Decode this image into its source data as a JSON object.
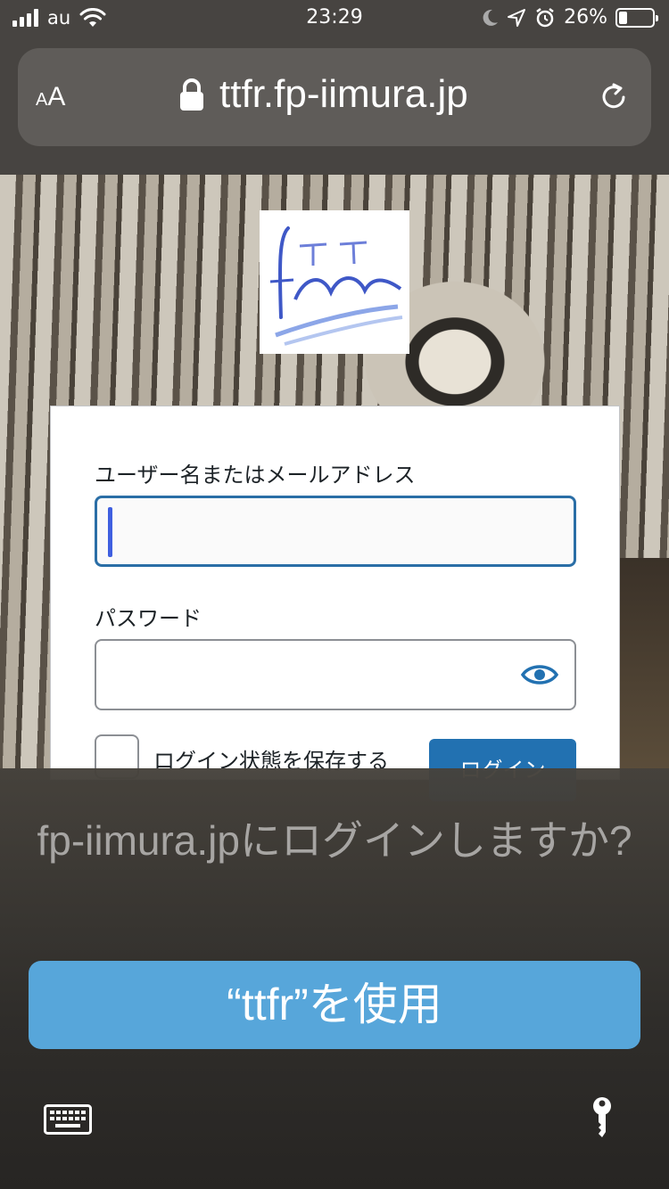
{
  "status_bar": {
    "carrier": "au",
    "time": "23:29",
    "battery_percent": "26%",
    "battery_level": 0.26
  },
  "browser": {
    "text_size_label_small": "A",
    "text_size_label_large": "A",
    "url": "ttfr.fp-iimura.jp"
  },
  "login_form": {
    "logo_text": "T.T freaks",
    "username_label": "ユーザー名またはメールアドレス",
    "username_value": "",
    "password_label": "パスワード",
    "password_value": "",
    "remember_label": "ログイン状態を保存する",
    "login_button": "ログイン"
  },
  "autofill": {
    "prompt": "fp-iimura.jpにログインしますか?",
    "use_button": "“ttfr”を使用"
  },
  "icons": {
    "signal": "cellular-signal-icon",
    "wifi": "wifi-icon",
    "moon": "do-not-disturb-icon",
    "location": "location-arrow-icon",
    "alarm": "alarm-clock-icon",
    "battery": "battery-icon",
    "lock": "lock-icon",
    "reload": "reload-icon",
    "eye": "show-password-icon",
    "keyboard": "keyboard-icon",
    "key": "key-icon"
  },
  "colors": {
    "accent": "#57a6da",
    "wp_blue": "#2271b1",
    "focus_border": "#2a6ea6"
  }
}
